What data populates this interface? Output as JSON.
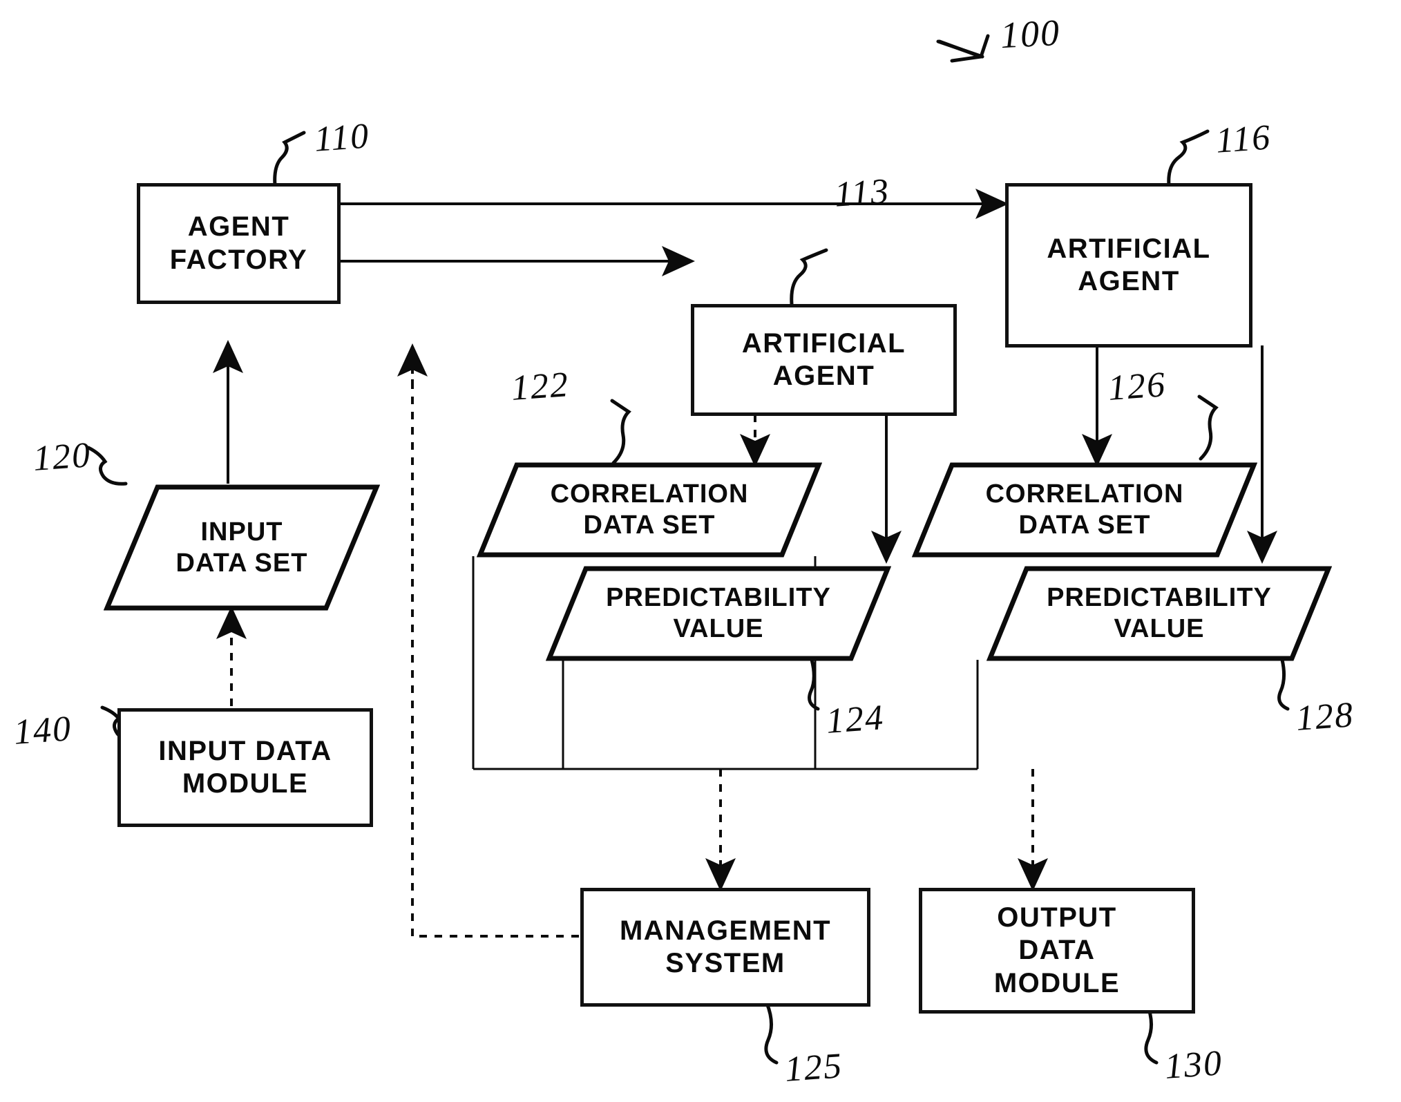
{
  "figure": {
    "system_ref": "100",
    "nodes": {
      "agent_factory": {
        "label": "AGENT\nFACTORY",
        "ref": "110"
      },
      "artificial_agent_mid": {
        "label": "ARTIFICIAL\nAGENT",
        "ref": "113"
      },
      "artificial_agent_right": {
        "label": "ARTIFICIAL\nAGENT",
        "ref": "116"
      },
      "input_data_set": {
        "label": "INPUT\nDATA SET",
        "ref": "120"
      },
      "input_data_module": {
        "label": "INPUT DATA\nMODULE",
        "ref": "140"
      },
      "correlation_data_set_mid": {
        "label": "CORRELATION\nDATA SET",
        "ref": "122"
      },
      "predictability_value_mid": {
        "label": "PREDICTABILITY\nVALUE",
        "ref": "124"
      },
      "correlation_data_set_right": {
        "label": "CORRELATION\nDATA SET",
        "ref": "126"
      },
      "predictability_value_right": {
        "label": "PREDICTABILITY\nVALUE",
        "ref": "128"
      },
      "management_system": {
        "label": "MANAGEMENT\nSYSTEM",
        "ref": "125"
      },
      "output_data_module": {
        "label": "OUTPUT\nDATA\nMODULE",
        "ref": "130"
      }
    },
    "colors": {
      "ink": "#0b0b0b",
      "background": "#ffffff"
    }
  }
}
